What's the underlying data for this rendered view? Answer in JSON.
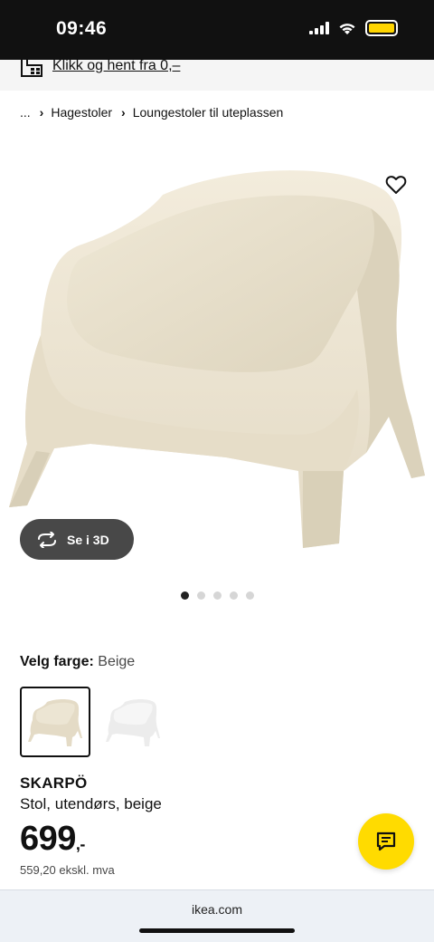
{
  "status_bar": {
    "time": "09:46"
  },
  "promo": {
    "text": "Klikk og hent fra 0,–"
  },
  "breadcrumb": {
    "ellipsis": "...",
    "items": [
      "Hagestoler",
      "Loungestoler til uteplassen"
    ]
  },
  "product_image": {
    "view3d_label": "Se i 3D",
    "carousel_count": 5,
    "carousel_active": 1
  },
  "color_picker": {
    "label": "Velg farge:",
    "selected_value": "Beige",
    "options": [
      "Beige",
      "White"
    ]
  },
  "product": {
    "name": "SKARPÖ",
    "description": "Stol, utendørs, beige",
    "price": "699",
    "price_suffix": ",-",
    "price_excl": "559,20 ekskl. mva"
  },
  "browser": {
    "url": "ikea.com"
  },
  "colors": {
    "accent_yellow": "#ffdb00",
    "chair_beige": "#e8e0cc",
    "chair_white": "#f2f2f2"
  }
}
